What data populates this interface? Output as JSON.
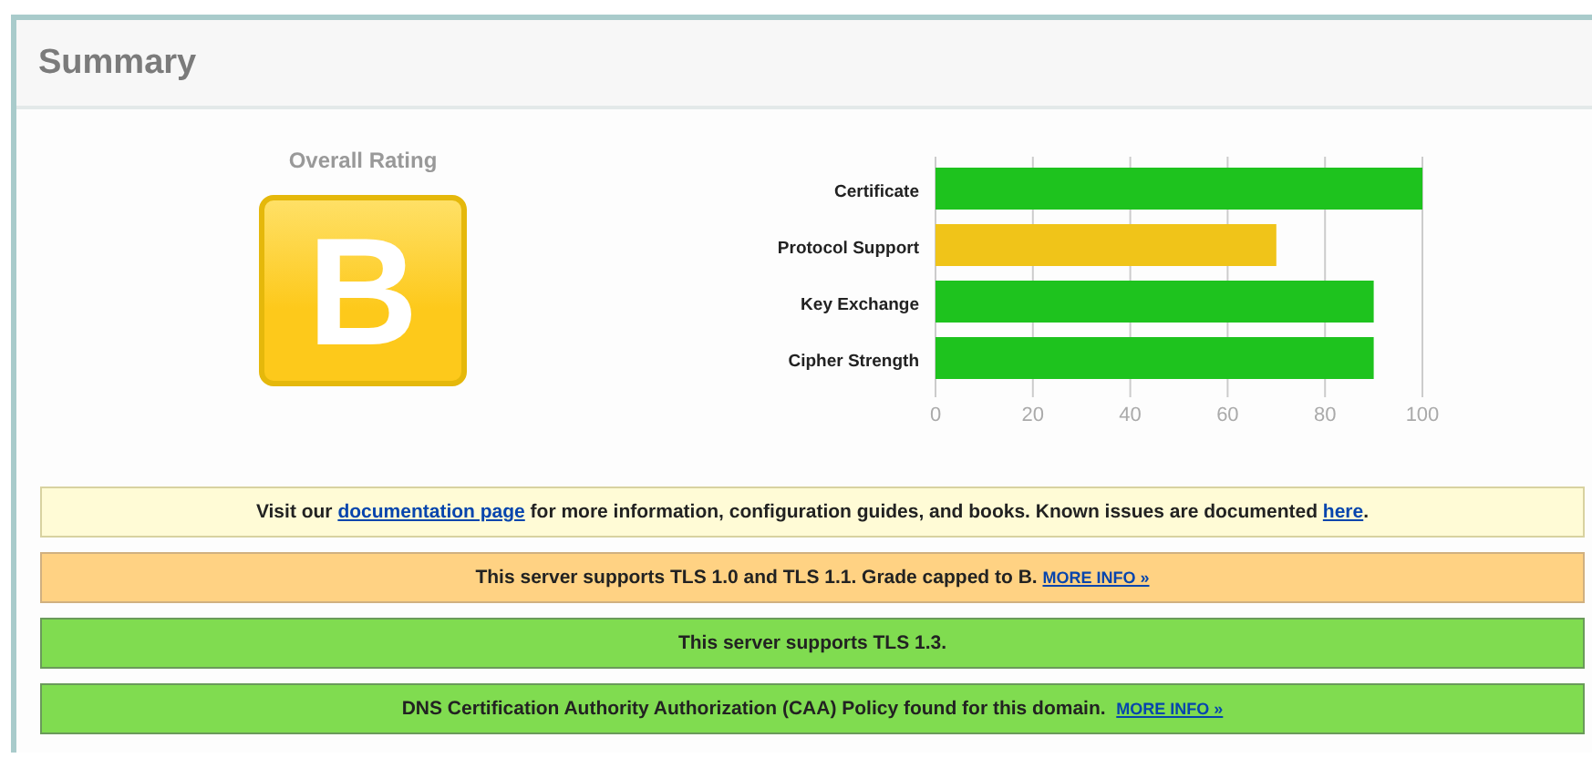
{
  "panel": {
    "title": "Summary"
  },
  "rating": {
    "label": "Overall Rating",
    "grade": "B",
    "color": "#fdc91b"
  },
  "chart_data": {
    "type": "bar",
    "orientation": "horizontal",
    "categories": [
      "Certificate",
      "Protocol Support",
      "Key Exchange",
      "Cipher Strength"
    ],
    "series": [
      {
        "color": "#1ec31e",
        "values": [
          100,
          null,
          90,
          90
        ]
      },
      {
        "color": "#f0c419",
        "values": [
          null,
          70,
          null,
          null
        ]
      }
    ],
    "stacked": true,
    "grid": true,
    "xlim": [
      0,
      100
    ],
    "xticks": [
      0,
      20,
      40,
      60,
      80,
      100
    ]
  },
  "messages": [
    {
      "kind": "info",
      "parts": [
        {
          "kind": "text",
          "text": "Visit our "
        },
        {
          "kind": "link",
          "text": "documentation page"
        },
        {
          "kind": "text",
          "text": " for more information, configuration guides, and books. Known issues are documented "
        },
        {
          "kind": "link",
          "text": "here"
        },
        {
          "kind": "text",
          "text": "."
        }
      ]
    },
    {
      "kind": "warning",
      "parts": [
        {
          "kind": "text",
          "text": "This server supports TLS 1.0 and TLS 1.1. Grade capped to B. "
        },
        {
          "kind": "more",
          "text": "MORE INFO »"
        }
      ]
    },
    {
      "kind": "good",
      "parts": [
        {
          "kind": "text",
          "text": "This server supports TLS 1.3."
        }
      ]
    },
    {
      "kind": "good",
      "parts": [
        {
          "kind": "text",
          "text": "DNS Certification Authority Authorization (CAA) Policy found for this domain.  "
        },
        {
          "kind": "more",
          "text": "MORE INFO »"
        }
      ]
    }
  ]
}
